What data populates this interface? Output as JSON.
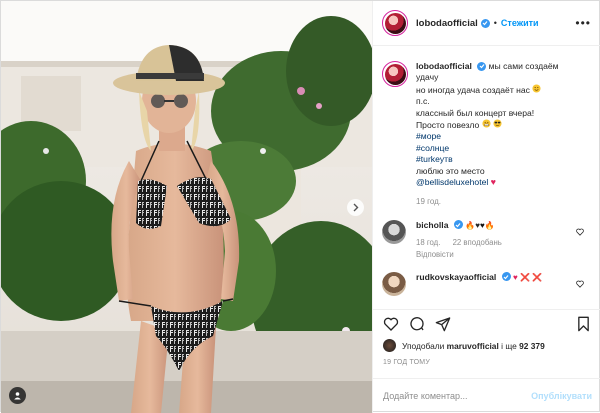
{
  "header": {
    "username": "lobodaofficial",
    "separator": "•",
    "follow_label": "Стежити"
  },
  "caption": {
    "username": "lobodaofficial",
    "line1": "мы сами создаём",
    "line2": "удачу",
    "line3": "но иногда удача создаёт нас",
    "line4": "п.с.",
    "line5": "классный был концерт вчера!",
    "line6": "Просто повезло",
    "hashtags": [
      "#море",
      "#солнце",
      "#turkeyтв"
    ],
    "line7": "люблю это место",
    "mention": "@bellisdeluxehotel",
    "time": "19 год."
  },
  "comments": [
    {
      "username": "bicholla",
      "text": "",
      "time": "18 год.",
      "likes": "22 вподобань",
      "reply": "Відповісти"
    },
    {
      "username": "rudkovskayaofficial",
      "text": ""
    }
  ],
  "likes": {
    "prefix": "Уподобали",
    "user": "maruvofficial",
    "middle": "і ще",
    "count": "92 379"
  },
  "post_time": "19 ГОД ТОМУ",
  "add_comment": {
    "placeholder": "Додайте коментар...",
    "publish_label": "Опублікувати"
  },
  "colors": {
    "accent": "#0095f6",
    "verified": "#3897f0",
    "hashtag": "#00376b",
    "muted": "#8e8e8e"
  }
}
